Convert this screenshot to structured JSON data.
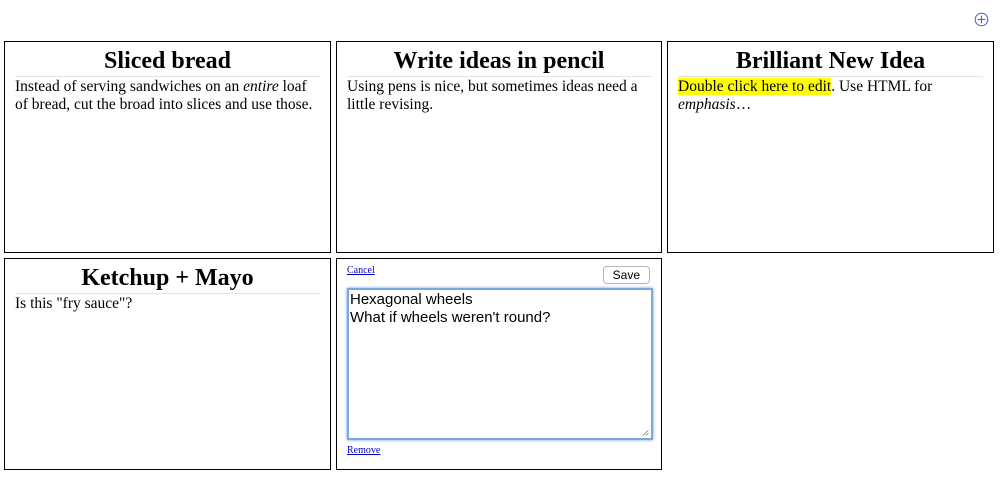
{
  "toolbar": {
    "add_icon": "plus-circle-icon",
    "accent": "#3b5bdb"
  },
  "notes": [
    {
      "title": "Sliced bread",
      "body_before": "Instead of serving sandwiches on an ",
      "body_em": "entire",
      "body_after": " loaf of bread, cut the broad into slices and use those."
    },
    {
      "title": "Write ideas in pencil",
      "body": "Using pens is nice, but sometimes ideas need a little revising."
    },
    {
      "title": "Brilliant New Idea",
      "body_highlight": "Double click here to edit",
      "body_after": ". Use HTML for ",
      "body_em": "emphasis",
      "body_end": "…",
      "highlight_color": "#ffff00"
    },
    {
      "title": "Ketchup + Mayo",
      "body": "Is this \"fry sauce\"?"
    }
  ],
  "editor": {
    "cancel_label": "Cancel",
    "save_label": "Save",
    "remove_label": "Remove",
    "text": "Hexagonal wheels\nWhat if wheels weren't round?"
  }
}
